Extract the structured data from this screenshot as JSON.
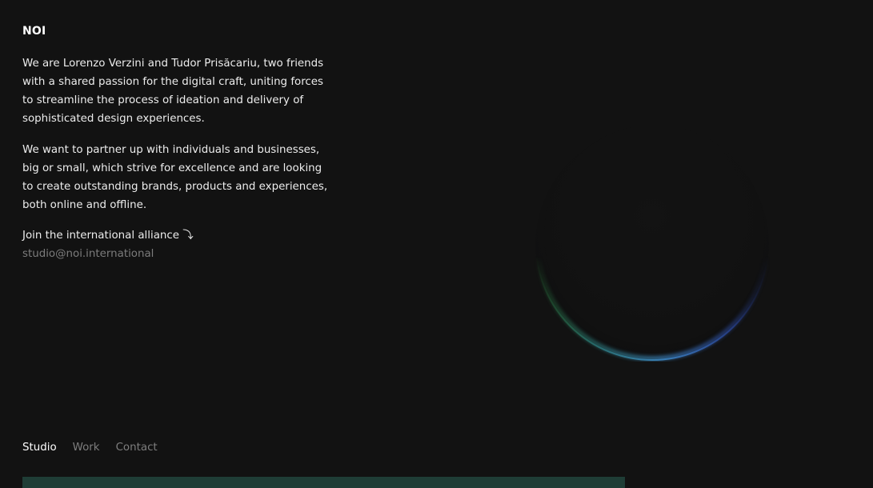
{
  "brand": {
    "name": "NOI"
  },
  "intro": {
    "paragraphs": [
      "We are Lorenzo Verzini and Tudor Prisăcariu, two friends with a shared passion for the digital craft, uniting forces to streamline the process of ideation and delivery of sophisticated design experiences.",
      "We want to partner up with individuals and businesses, big or small, which strive for excellence and are looking to create outstanding brands, products and experiences, both online and offline."
    ]
  },
  "cta": {
    "join_label": "Join the international alliance ⤵",
    "email": "studio@noi.international"
  },
  "nav": {
    "items": [
      {
        "label": "Studio",
        "active": true
      },
      {
        "label": "Work",
        "active": false
      },
      {
        "label": "Contact",
        "active": false
      }
    ]
  },
  "colors": {
    "background": "#121212",
    "text": "#ededed",
    "muted": "#7c7c7c",
    "panel": "#1f3d36",
    "orb_rim_blue": "#3a7fb8",
    "orb_rim_green": "#2f8a3e"
  }
}
